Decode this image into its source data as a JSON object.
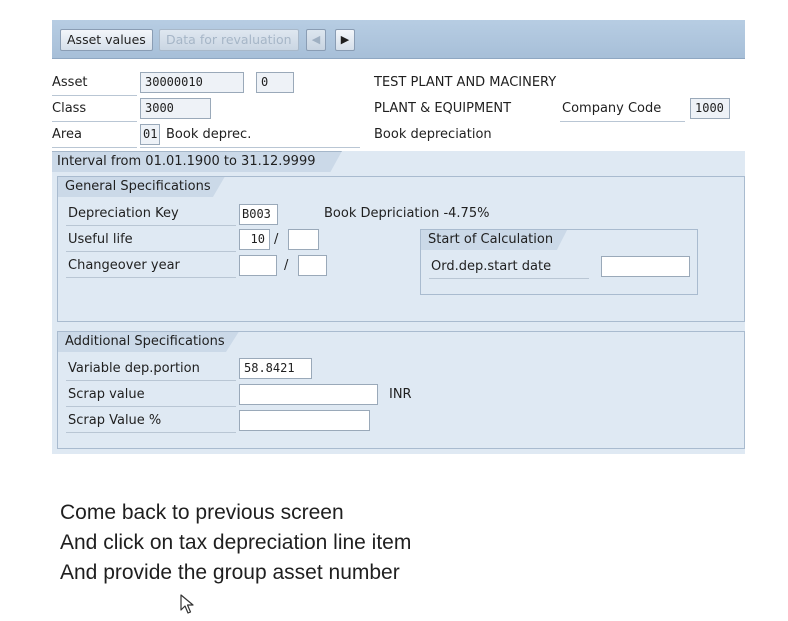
{
  "toolbar": {
    "asset_values_label": "Asset values",
    "data_revaluation_label": "Data for revaluation",
    "prev_icon": "◀",
    "next_icon": "▶"
  },
  "header": {
    "asset_label": "Asset",
    "asset_number": "30000010",
    "asset_sub_number": "0",
    "asset_description": "TEST PLANT AND MACINERY",
    "class_label": "Class",
    "class_value": "3000",
    "class_description": "PLANT & EQUIPMENT",
    "company_code_label": "Company Code",
    "company_code_value": "1000",
    "area_label": "Area",
    "area_value": "01",
    "area_short_text": "Book deprec.",
    "area_description": "Book depreciation"
  },
  "interval": {
    "text": "Interval from 01.01.1900 to 31.12.9999"
  },
  "general_specs": {
    "title": "General Specifications",
    "dep_key_label": "Depreciation Key",
    "dep_key_value": "B003",
    "dep_key_description": "Book Depriciation -4.75%",
    "useful_life_label": "Useful life",
    "useful_life_years": "10",
    "useful_life_periods": "",
    "changeover_label": "Changeover year",
    "changeover_year": "",
    "changeover_period": "",
    "slash": "/",
    "start_calc_title": "Start of Calculation",
    "ord_dep_label": "Ord.dep.start date",
    "ord_dep_value": ""
  },
  "additional_specs": {
    "title": "Additional Specifications",
    "variable_dep_label": "Variable dep.portion",
    "variable_dep_value": "58.8421",
    "scrap_value_label": "Scrap value",
    "scrap_value": "",
    "currency": "INR",
    "scrap_pct_label": "Scrap Value %",
    "scrap_pct_value": ""
  },
  "captions": [
    "Come back to previous screen",
    "And click on tax depreciation line item",
    "And provide the group asset number"
  ],
  "colors": {
    "toolbar": "#a7bfd8",
    "panel": "#dfe9f3",
    "section": "#cbd9e8"
  }
}
